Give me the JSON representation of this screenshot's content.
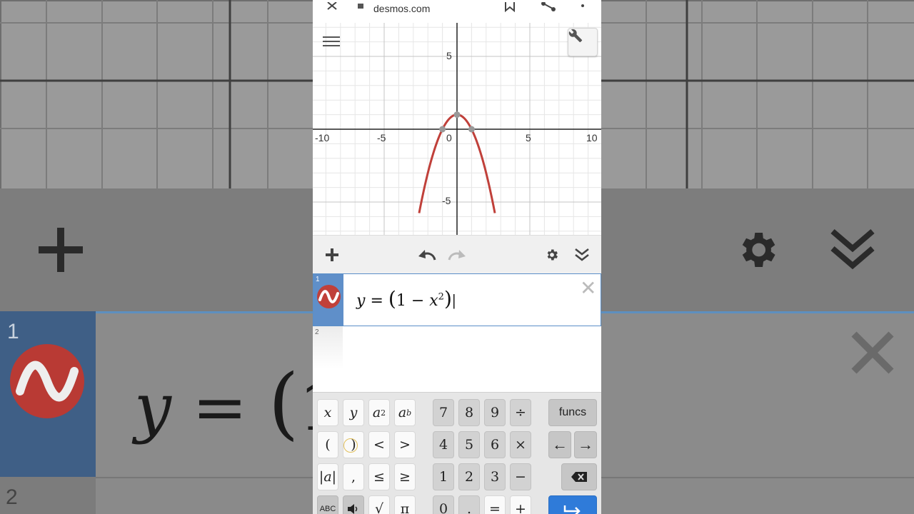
{
  "browser": {
    "url": "desmos.com",
    "icons": [
      "close-icon",
      "lock-icon",
      "bookmark-icon",
      "share-icon",
      "more-vert-icon"
    ]
  },
  "graph": {
    "x_ticks": [
      "-10",
      "-5",
      "0",
      "5",
      "10"
    ],
    "y_ticks": [
      "5",
      "-5"
    ],
    "curve_color": "#c0403a",
    "equation": "y = 1 - x^2"
  },
  "toolbar": {
    "icons": [
      "plus-icon",
      "undo-icon",
      "redo-icon",
      "gear-icon",
      "collapse-icon"
    ]
  },
  "expressions": [
    {
      "index": "1",
      "math": {
        "lhs": "y",
        "eq": "=",
        "open": "(",
        "one": "1",
        "minus": "−",
        "var": "x",
        "exp": "2",
        "close": ")",
        "cursor": "|"
      }
    },
    {
      "index": "2"
    }
  ],
  "keypad": {
    "row1": [
      "x",
      "y",
      "a²",
      "aᵇ",
      "7",
      "8",
      "9",
      "÷",
      "funcs"
    ],
    "row2": [
      "(",
      ")",
      "<",
      ">",
      "4",
      "5",
      "6",
      "×",
      "←",
      "→"
    ],
    "row3": [
      "|a|",
      ",",
      "≤",
      "≥",
      "1",
      "2",
      "3",
      "−"
    ],
    "row4": [
      "ABC",
      "",
      "√",
      "π",
      "0",
      ".",
      "=",
      "+"
    ],
    "row1_exp": {
      "a": "a",
      "two": "2",
      "b": "b"
    }
  },
  "colors": {
    "accent": "#2f7bd9",
    "tab": "#5f8fc9",
    "curve": "#c0403a"
  }
}
